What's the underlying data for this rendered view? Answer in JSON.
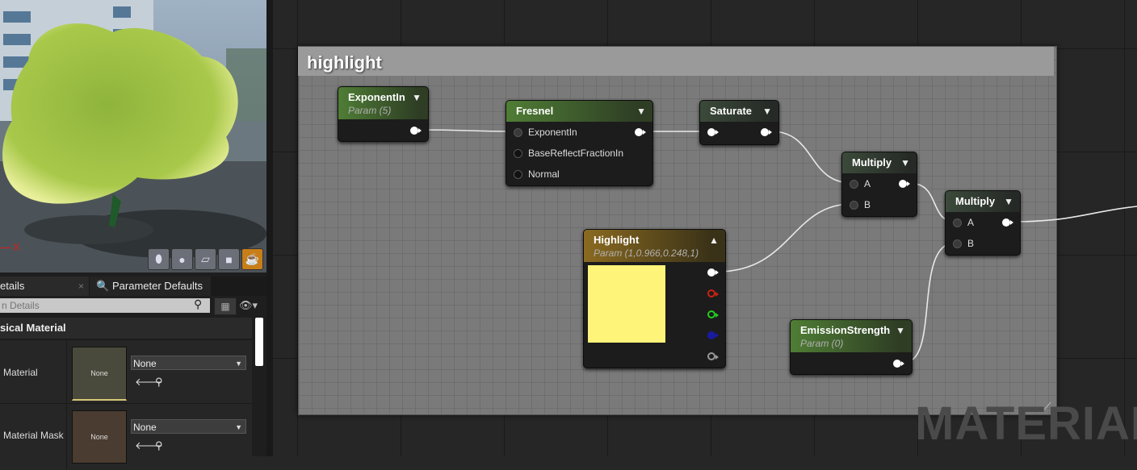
{
  "viewport": {
    "axis_label": "X",
    "buttons": [
      {
        "icon": "cylinder-icon",
        "active": false
      },
      {
        "icon": "sphere-icon",
        "active": false
      },
      {
        "icon": "plane-icon",
        "active": false
      },
      {
        "icon": "cube-icon",
        "active": false
      },
      {
        "icon": "teapot-icon",
        "active": true
      }
    ]
  },
  "panel": {
    "tabs": [
      {
        "label": "etails",
        "close": "×"
      },
      {
        "label": "Parameter Defaults"
      }
    ],
    "search_placeholder": "n Details",
    "category": "sical Material",
    "rows": [
      {
        "label": "Material",
        "thumb": "None",
        "value": "None"
      },
      {
        "label": "Material Mask",
        "thumb": "None",
        "value": "None"
      }
    ]
  },
  "graph": {
    "comment_title": "highlight",
    "watermark": "MATERIAL",
    "accent_color": "#fff47a",
    "nodes": {
      "exponent_in": {
        "title": "ExponentIn",
        "subtitle": "Param (5)"
      },
      "fresnel": {
        "title": "Fresnel",
        "inputs": [
          "ExponentIn",
          "BaseReflectFractionIn",
          "Normal"
        ]
      },
      "saturate": {
        "title": "Saturate"
      },
      "multiply1": {
        "title": "Multiply",
        "inputs": [
          "A",
          "B"
        ]
      },
      "multiply2": {
        "title": "Multiply",
        "inputs": [
          "A",
          "B"
        ]
      },
      "highlight": {
        "title": "Highlight",
        "subtitle": "Param (1,0.966,0.248,1)",
        "swatch_color": "#fff47a"
      },
      "emission": {
        "title": "EmissionStrength",
        "subtitle": "Param (0)"
      }
    }
  }
}
